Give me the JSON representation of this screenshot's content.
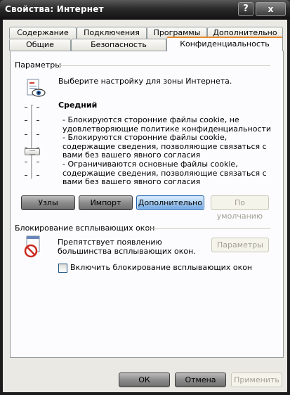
{
  "window": {
    "title": "Свойства: Интернет",
    "help_label": "?",
    "close_label": "x"
  },
  "tabs": {
    "row1": [
      "Содержание",
      "Подключения",
      "Программы",
      "Дополнительно"
    ],
    "row2": [
      "Общие",
      "Безопасность",
      "Конфиденциальность"
    ],
    "active": "Конфиденциальность"
  },
  "settings": {
    "group_label": "Параметры",
    "zone_text": "Выберите настройку для зоны Интернета.",
    "level_title": "Средний",
    "level": "Средний",
    "descriptions": [
      "- Блокируются сторонние файлы cookie, не удовлетворяющие политике конфиденциальности",
      "- Блокируются сторонние файлы cookie, содержащие сведения, позволяющие связаться с вами без вашего явного согласия",
      "- Ограничиваются основные файлы cookie, содержащие сведения, позволяющие связаться с вами без вашего явного согласия"
    ],
    "buttons": {
      "sites": "Узлы",
      "import": "Импорт",
      "advanced": "Дополнительно",
      "default": "По умолчанию"
    }
  },
  "popup": {
    "group_label": "Блокирование всплывающих окон",
    "description": "Препятствует появлению большинства всплывающих окон.",
    "settings_button": "Параметры",
    "checkbox_label": "Включить блокирование всплывающих окон",
    "checkbox_checked": false
  },
  "footer": {
    "ok": "ОК",
    "cancel": "Отмена",
    "apply": "Применить"
  },
  "icons": {
    "privacy": "privacy-eye-icon",
    "popup_blocker": "popup-blocked-icon"
  },
  "colors": {
    "titlebar": "#1c1c1c",
    "panel": "#fcfcfe",
    "dialog": "#ebe9e4",
    "active_tab_accent": "#e68b2c",
    "focused_button": "#a9cdf3"
  }
}
